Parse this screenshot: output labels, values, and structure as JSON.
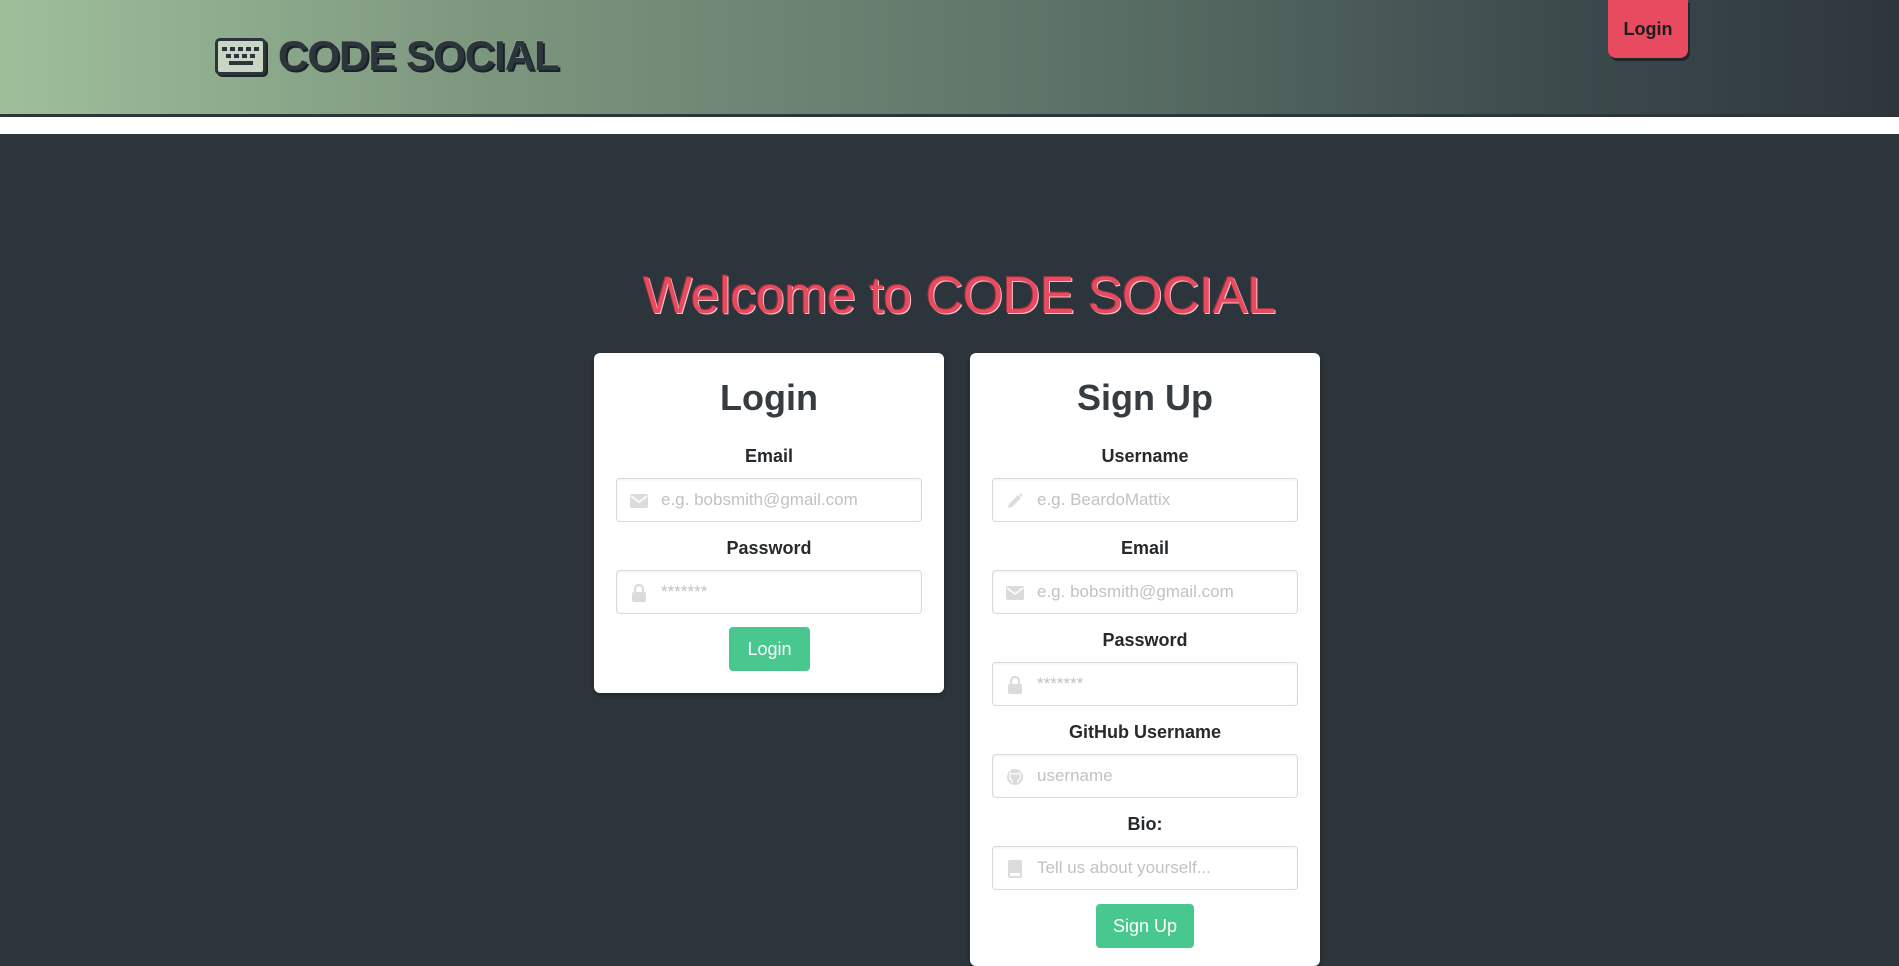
{
  "header": {
    "logo_text": "CODE SOCIAL",
    "login_button": "Login"
  },
  "welcome": "Welcome to CODE SOCIAL",
  "login_card": {
    "title": "Login",
    "email_label": "Email",
    "email_placeholder": "e.g. bobsmith@gmail.com",
    "password_label": "Password",
    "password_placeholder": "*******",
    "submit": "Login"
  },
  "signup_card": {
    "title": "Sign Up",
    "username_label": "Username",
    "username_placeholder": "e.g. BeardoMattix",
    "email_label": "Email",
    "email_placeholder": "e.g. bobsmith@gmail.com",
    "password_label": "Password",
    "password_placeholder": "*******",
    "github_label": "GitHub Username",
    "github_placeholder": "username",
    "bio_label": "Bio:",
    "bio_placeholder": "Tell us about yourself...",
    "submit": "Sign Up"
  },
  "colors": {
    "accent": "#e84a5f",
    "button_green": "#48c78e",
    "background": "#2c353b"
  },
  "icons": [
    "keyboard-icon",
    "envelope-icon",
    "lock-icon",
    "pencil-icon",
    "github-icon",
    "book-icon"
  ]
}
